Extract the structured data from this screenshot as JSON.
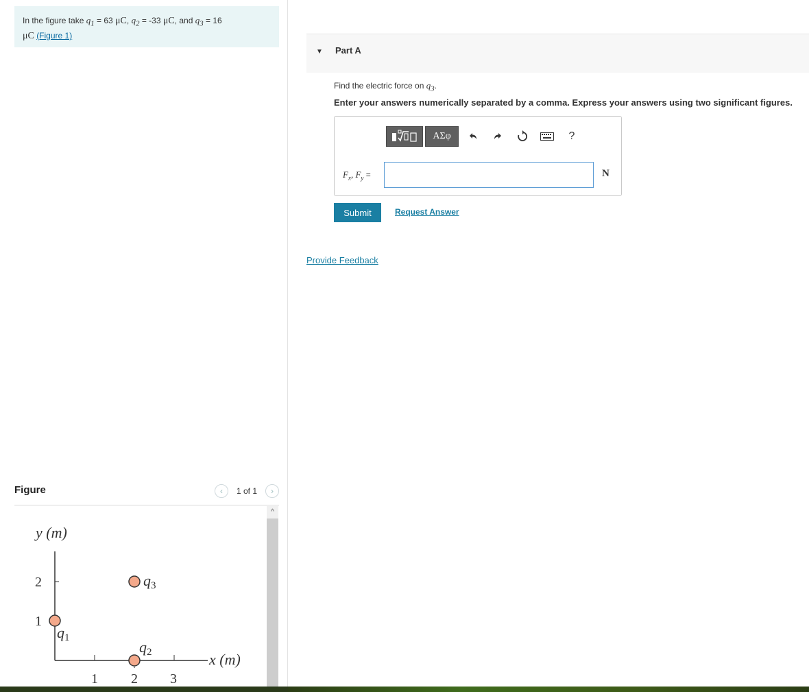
{
  "problem": {
    "prefix": "In the figure take",
    "q1_sym": "q",
    "q1_sub": "1",
    "q1_val": "= 63",
    "q2_sym": "q",
    "q2_sub": "2",
    "q2_val": "= -33",
    "q3_sym": "q",
    "q3_sub": "3",
    "q3_val": "= 16",
    "unit": "μC",
    "sep": ",",
    "and": ", and",
    "figure_link": "(Figure 1)"
  },
  "figure": {
    "title": "Figure",
    "pager": "1 of 1",
    "prev_icon": "chevron-left-icon",
    "next_icon": "chevron-right-icon",
    "y_axis_label": "y (m)",
    "x_axis_label": "x (m)",
    "x_ticks": [
      "1",
      "2",
      "3"
    ],
    "y_ticks": [
      "1",
      "2"
    ],
    "charges": [
      {
        "label": "q",
        "sub": "1",
        "x": 0,
        "y": 1
      },
      {
        "label": "q",
        "sub": "2",
        "x": 2,
        "y": 0
      },
      {
        "label": "q",
        "sub": "3",
        "x": 2,
        "y": 2
      }
    ],
    "charge_color": "#f4a98b"
  },
  "part": {
    "arrow_icon": "triangle-down-icon",
    "title": "Part A",
    "question_prefix": "Find the electric force on",
    "question_sym": "q",
    "question_sub": "3",
    "question_suffix": ".",
    "instructions": "Enter your answers numerically separated by a comma. Express your answers using two significant figures.",
    "toolbar": {
      "templates_icon": "templates-icon",
      "greek": "ΑΣφ",
      "undo_icon": "undo-icon",
      "redo_icon": "redo-icon",
      "reset_icon": "reset-icon",
      "keyboard_icon": "keyboard-icon",
      "help": "?"
    },
    "answer_label_fx": "F",
    "answer_label_fx_sub": "x",
    "answer_label_comma": ", ",
    "answer_label_fy": "F",
    "answer_label_fy_sub": "y",
    "answer_label_eq": " =",
    "answer_value": "",
    "answer_unit": "N",
    "submit": "Submit",
    "request_answer": "Request Answer"
  },
  "feedback": "Provide Feedback",
  "colors": {
    "accent": "#1a7fa3",
    "problem_bg": "#e9f5f6"
  }
}
